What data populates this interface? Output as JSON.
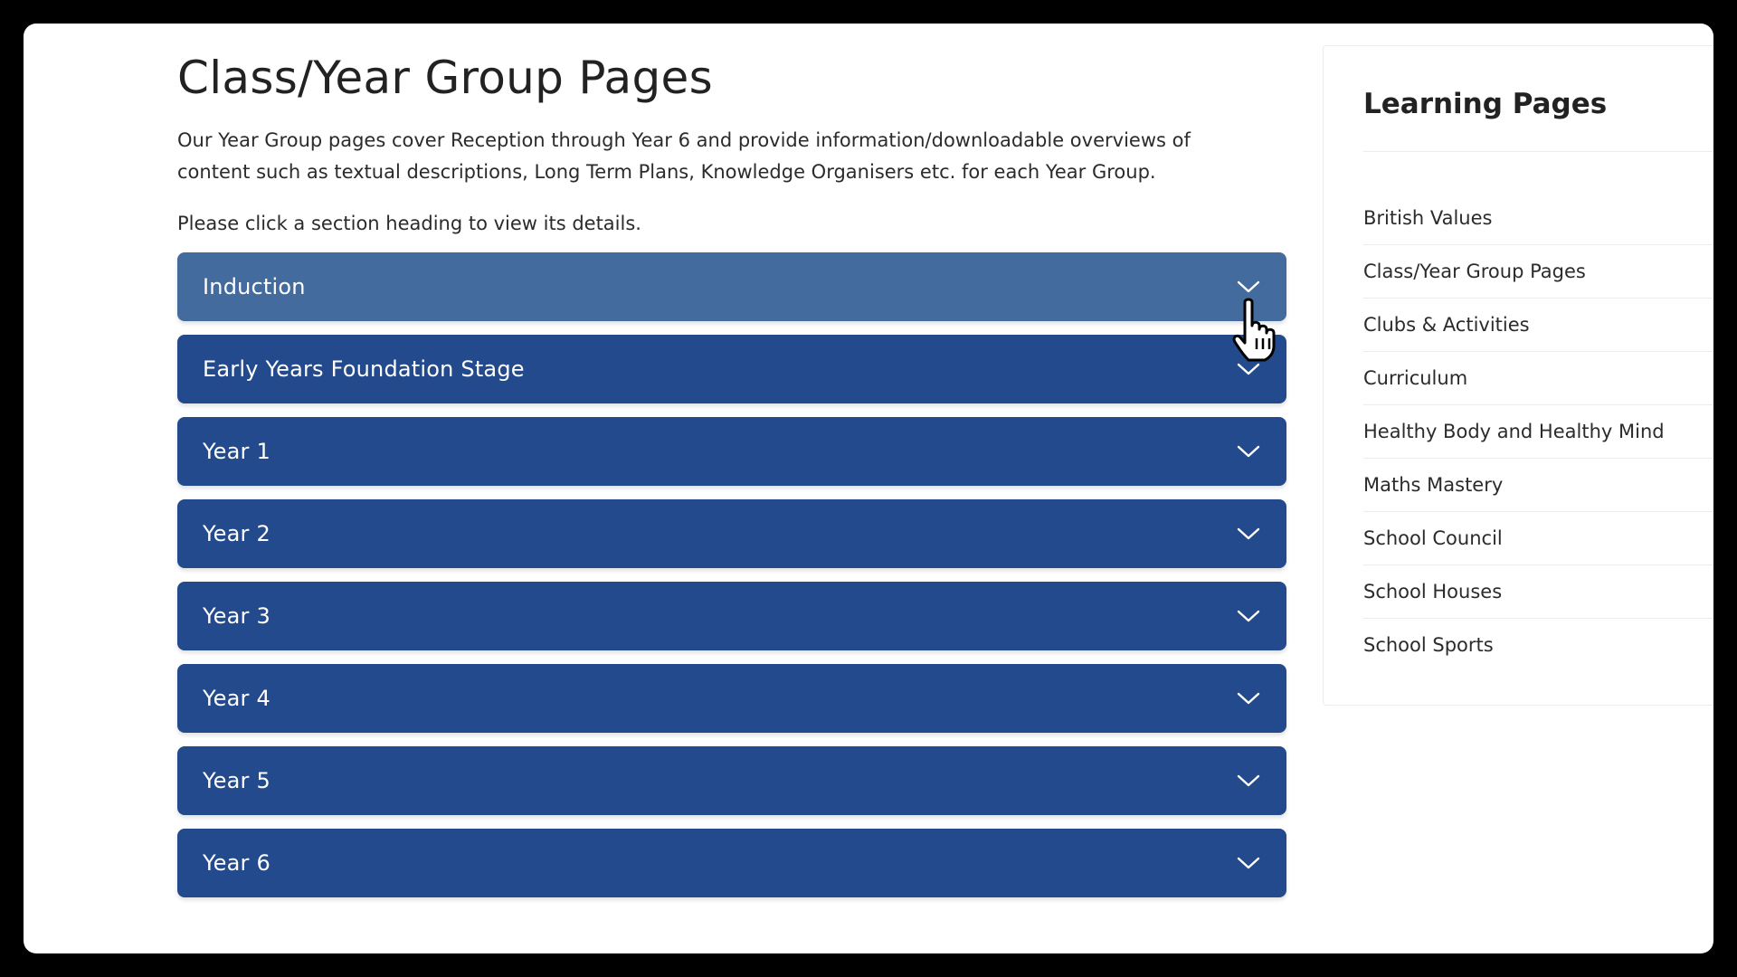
{
  "main": {
    "title": "Class/Year Group Pages",
    "intro": "Our Year Group pages cover Reception through Year 6 and provide information/downloadable overviews of content such as textual descriptions, Long Term Plans, Knowledge Organisers etc. for each Year Group.",
    "hint": "Please click a section heading to view its details.",
    "accordion": [
      {
        "label": "Induction",
        "state": "hover"
      },
      {
        "label": "Early Years Foundation Stage",
        "state": "collapsed"
      },
      {
        "label": "Year 1",
        "state": "collapsed"
      },
      {
        "label": "Year 2",
        "state": "collapsed"
      },
      {
        "label": "Year 3",
        "state": "collapsed"
      },
      {
        "label": "Year 4",
        "state": "collapsed"
      },
      {
        "label": "Year 5",
        "state": "collapsed"
      },
      {
        "label": "Year 6",
        "state": "collapsed"
      }
    ]
  },
  "sidebar": {
    "title": "Learning Pages",
    "items": [
      {
        "label": "British Values"
      },
      {
        "label": "Class/Year Group Pages"
      },
      {
        "label": "Clubs & Activities"
      },
      {
        "label": "Curriculum"
      },
      {
        "label": "Healthy Body and Healthy Mind"
      },
      {
        "label": "Maths Mastery"
      },
      {
        "label": "School Council"
      },
      {
        "label": "School Houses"
      },
      {
        "label": "School Sports"
      }
    ]
  },
  "colors": {
    "accordion_bg": "#234a8c",
    "accordion_hover_bg": "#436b9e",
    "text": "#2b2b2b",
    "window_bg": "#ffffff",
    "frame_bg": "#000000"
  },
  "icons": {
    "accordion_toggle": "chevron-down-icon",
    "cursor": "hand-pointer-icon"
  }
}
